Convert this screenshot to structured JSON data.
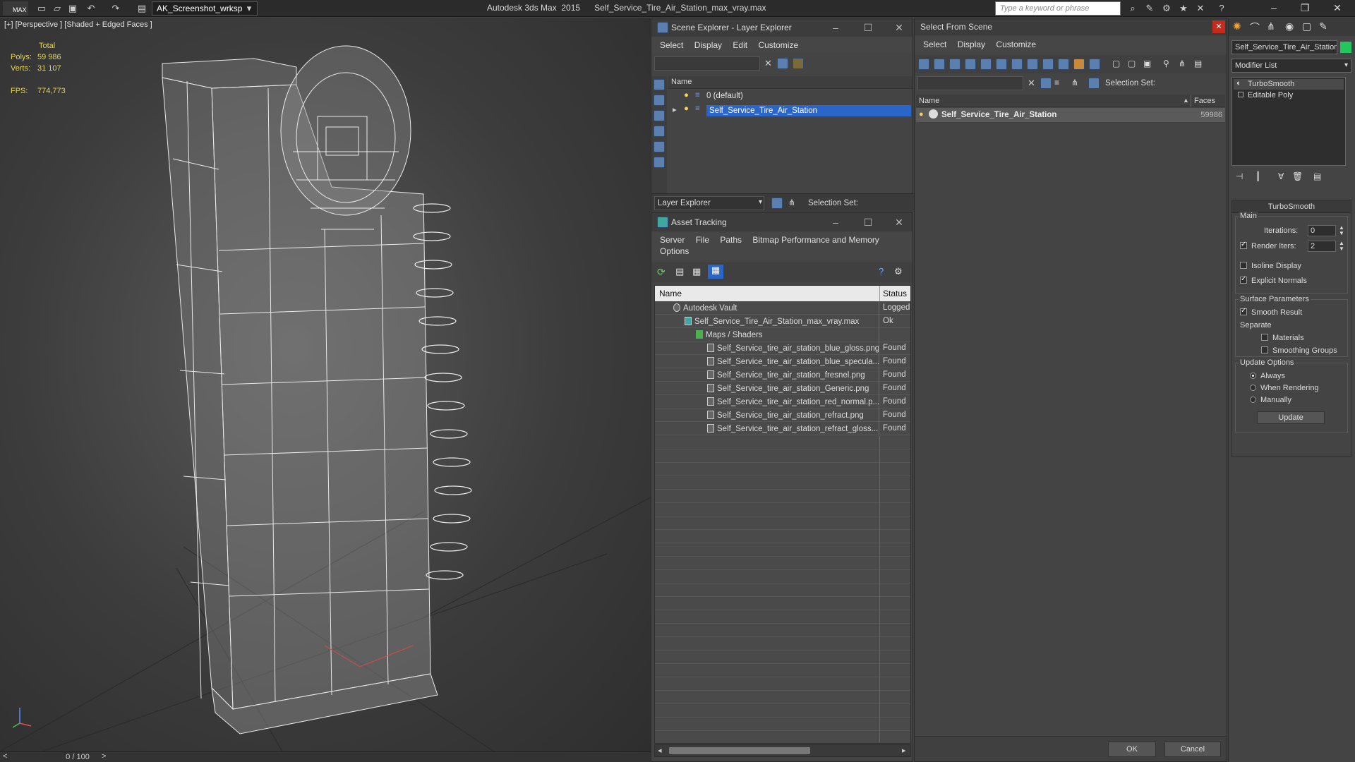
{
  "titlebar": {
    "logo": "MAX",
    "workspace": "AK_Screenshot_wrksp",
    "app_name": "Autodesk 3ds Max  2015",
    "file_name": "Self_Service_Tire_Air_Station_max_vray.max",
    "search_placeholder": "Type a keyword or phrase"
  },
  "viewport": {
    "label": "[+] [Perspective ] [Shaded + Edged Faces ]",
    "stats": {
      "total_label": "Total",
      "polys_label": "Polys:",
      "polys_value": "59 986",
      "verts_label": "Verts:",
      "verts_value": "31 107",
      "fps_label": "FPS:",
      "fps_value": "774,773"
    },
    "time_slider": "0 / 100",
    "prev": "<",
    "next": ">"
  },
  "scene_explorer": {
    "title": "Scene Explorer - Layer Explorer",
    "menu": [
      "Select",
      "Display",
      "Edit",
      "Customize"
    ],
    "column_name": "Name",
    "rows": [
      {
        "label": "0 (default)",
        "selected": false
      },
      {
        "label": "Self_Service_Tire_Air_Station",
        "selected": true
      }
    ],
    "footer_dropdown": "Layer Explorer",
    "selection_set_label": "Selection Set:"
  },
  "asset_tracking": {
    "title": "Asset Tracking",
    "menu": [
      "Server",
      "File",
      "Paths",
      "Bitmap Performance and Memory",
      "Options"
    ],
    "col_name": "Name",
    "col_status": "Status",
    "rows": [
      {
        "name": "Autodesk Vault",
        "status": "Logged",
        "indent": 1
      },
      {
        "name": "Self_Service_Tire_Air_Station_max_vray.max",
        "status": "Ok",
        "indent": 2
      },
      {
        "name": "Maps / Shaders",
        "status": "",
        "indent": 3
      },
      {
        "name": "Self_Service_tire_air_station_blue_gloss.png",
        "status": "Found",
        "indent": 4
      },
      {
        "name": "Self_Service_tire_air_station_blue_specula...",
        "status": "Found",
        "indent": 4
      },
      {
        "name": "Self_Service_tire_air_station_fresnel.png",
        "status": "Found",
        "indent": 4
      },
      {
        "name": "Self_Service_tire_air_station_Generic.png",
        "status": "Found",
        "indent": 4
      },
      {
        "name": "Self_Service_tire_air_station_red_normal.p...",
        "status": "Found",
        "indent": 4
      },
      {
        "name": "Self_Service_tire_air_station_refract.png",
        "status": "Found",
        "indent": 4
      },
      {
        "name": "Self_Service_tire_air_station_refract_gloss....",
        "status": "Found",
        "indent": 4
      }
    ]
  },
  "select_from_scene": {
    "title": "Select From Scene",
    "menu": [
      "Select",
      "Display",
      "Customize"
    ],
    "selection_set_label": "Selection Set:",
    "col_name": "Name",
    "col_faces": "Faces",
    "rows": [
      {
        "name": "Self_Service_Tire_Air_Station",
        "faces": "59986"
      }
    ],
    "ok_label": "OK",
    "cancel_label": "Cancel"
  },
  "command_panel": {
    "object_name": "Self_Service_Tire_Air_Station",
    "object_color": "#22c55e",
    "modifier_list_label": "Modifier List",
    "stack": [
      "TurboSmooth",
      "Editable Poly"
    ],
    "rollout_title": "TurboSmooth",
    "main_label": "Main",
    "iterations_label": "Iterations:",
    "iterations_value": "0",
    "render_iters_label": "Render Iters:",
    "render_iters_value": "2",
    "isoline_label": "Isoline Display",
    "explicit_normals_label": "Explicit Normals",
    "surface_params_label": "Surface Parameters",
    "smooth_result_label": "Smooth Result",
    "separate_label": "Separate",
    "materials_label": "Materials",
    "smoothing_groups_label": "Smoothing Groups",
    "update_options_label": "Update Options",
    "always_label": "Always",
    "when_rendering_label": "When Rendering",
    "manually_label": "Manually",
    "update_button": "Update"
  },
  "colors": {
    "selection_blue": "#2a66c9",
    "stats_yellow": "#e8d74a",
    "close_red": "#c42b1c"
  }
}
